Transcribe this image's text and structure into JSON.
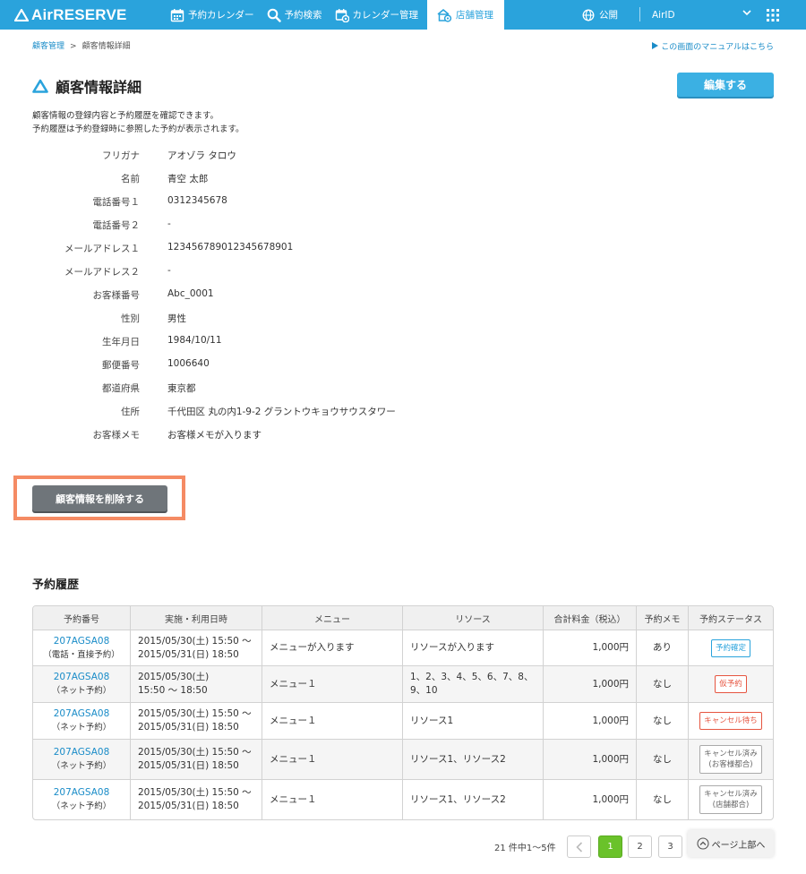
{
  "header": {
    "logo": "AirRESERVE",
    "nav": [
      {
        "label": "予約カレンダー",
        "icon": "calendar-icon"
      },
      {
        "label": "予約検索",
        "icon": "search-icon"
      },
      {
        "label": "カレンダー管理",
        "icon": "calendar-settings-icon"
      },
      {
        "label": "店舗管理",
        "icon": "store-settings-icon",
        "active": true
      }
    ],
    "publish_label": "公開",
    "airid_label": "AirID",
    "accent_color": "#2aa3dc"
  },
  "breadcrumb": {
    "parent": "顧客管理",
    "separator": ">",
    "current": "顧客情報詳細"
  },
  "manual_link": "この画面のマニュアルはこちら",
  "page": {
    "title": "顧客情報詳細",
    "edit_label": "編集する",
    "desc_line1": "顧客情報の登録内容と予約履歴を確認できます。",
    "desc_line2": "予約履歴は予約登録時に参照した予約が表示されます。"
  },
  "details": [
    {
      "label": "フリガナ",
      "value": "アオゾラ タロウ"
    },
    {
      "label": "名前",
      "value": "青空 太郎"
    },
    {
      "label": "電話番号１",
      "value": "0312345678"
    },
    {
      "label": "電話番号２",
      "value": "-"
    },
    {
      "label": "メールアドレス１",
      "value": "123456789012345678901"
    },
    {
      "label": "メールアドレス２",
      "value": "-"
    },
    {
      "label": "お客様番号",
      "value": "Abc_0001"
    },
    {
      "label": "性別",
      "value": "男性"
    },
    {
      "label": "生年月日",
      "value": "1984/10/11"
    },
    {
      "label": "郵便番号",
      "value": "1006640"
    },
    {
      "label": "都道府県",
      "value": "東京都"
    },
    {
      "label": "住所",
      "value": "千代田区 丸の内1-9-2 グラントウキョウサウスタワー"
    },
    {
      "label": "お客様メモ",
      "value": "お客様メモが入ります"
    }
  ],
  "delete_label": "顧客情報を削除する",
  "history": {
    "title": "予約履歴",
    "columns": [
      "予約番号",
      "実施・利用日時",
      "メニュー",
      "リソース",
      "合計料金（税込）",
      "予約メモ",
      "予約ステータス"
    ],
    "rows": [
      {
        "no": "207AGSA08",
        "channel": "（電話・直接予約）",
        "date1": "2015/05/30(土) 15:50 〜",
        "date2": "2015/05/31(日) 18:50",
        "menu": "メニューが入ります",
        "resource1": "リソースが入ります",
        "resource2": "",
        "price": "1,000円",
        "memo": "あり",
        "status1": "予約確定",
        "status2": "",
        "status_type": "confirm"
      },
      {
        "no": "207AGSA08",
        "channel": "（ネット予約）",
        "date1": "2015/05/30(土)",
        "date2": "15:50 〜 18:50",
        "menu": "メニュー１",
        "resource1": "1、2、3、4、5、6、7、8、",
        "resource2": "9、10",
        "price": "1,000円",
        "memo": "なし",
        "status1": "仮予約",
        "status2": "",
        "status_type": "temp"
      },
      {
        "no": "207AGSA08",
        "channel": "（ネット予約）",
        "date1": "2015/05/30(土) 15:50 〜",
        "date2": "2015/05/31(日) 18:50",
        "menu": "メニュー１",
        "resource1": "リソース1",
        "resource2": "",
        "price": "1,000円",
        "memo": "なし",
        "status1": "キャンセル待ち",
        "status2": "",
        "status_type": "wait"
      },
      {
        "no": "207AGSA08",
        "channel": "（ネット予約）",
        "date1": "2015/05/30(土) 15:50 〜",
        "date2": "2015/05/31(日) 18:50",
        "menu": "メニュー１",
        "resource1": "リソース1、リソース2",
        "resource2": "",
        "price": "1,000円",
        "memo": "なし",
        "status1": "キャンセル済み",
        "status2": "(お客様都合)",
        "status_type": "cancel"
      },
      {
        "no": "207AGSA08",
        "channel": "（ネット予約）",
        "date1": "2015/05/30(土) 15:50 〜",
        "date2": "2015/05/31(日) 18:50",
        "menu": "メニュー１",
        "resource1": "リソース1、リソース2",
        "resource2": "",
        "price": "1,000円",
        "memo": "なし",
        "status1": "キャンセル済み",
        "status2": "(店舗都合)",
        "status_type": "cancel"
      }
    ]
  },
  "pagination": {
    "count": "21 件中1〜5件",
    "pages": [
      "1",
      "2",
      "3"
    ],
    "active": "1",
    "to_top": "ページ上部へ"
  }
}
